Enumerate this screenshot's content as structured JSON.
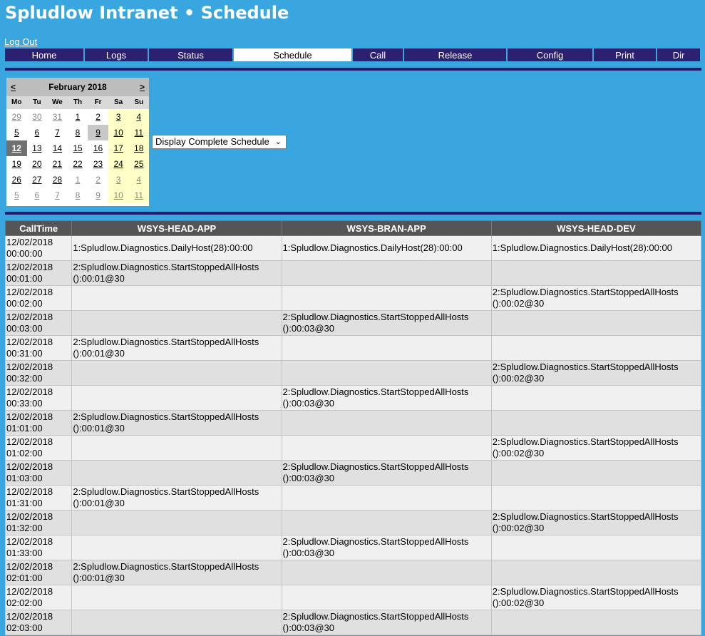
{
  "header": {
    "title": "Spludlow Intranet • Schedule",
    "logout": "Log Out"
  },
  "nav": [
    {
      "label": "Home",
      "active": false
    },
    {
      "label": "Logs",
      "active": false
    },
    {
      "label": "Status",
      "active": false
    },
    {
      "label": "Schedule",
      "active": true
    },
    {
      "label": "Call",
      "active": false
    },
    {
      "label": "Release",
      "active": false
    },
    {
      "label": "Config",
      "active": false
    },
    {
      "label": "Print",
      "active": false
    },
    {
      "label": "Dir",
      "active": false
    }
  ],
  "calendar": {
    "prev": "<",
    "next": ">",
    "month": "February 2018",
    "dows": [
      "Mo",
      "Tu",
      "We",
      "Th",
      "Fr",
      "Sa",
      "Su"
    ],
    "weeks": [
      [
        "29",
        "30",
        "31",
        "1",
        "2",
        "3",
        "4"
      ],
      [
        "5",
        "6",
        "7",
        "8",
        "9",
        "10",
        "11"
      ],
      [
        "12",
        "13",
        "14",
        "15",
        "16",
        "17",
        "18"
      ],
      [
        "19",
        "20",
        "21",
        "22",
        "23",
        "24",
        "25"
      ],
      [
        "26",
        "27",
        "28",
        "1",
        "2",
        "3",
        "4"
      ],
      [
        "5",
        "6",
        "7",
        "8",
        "9",
        "10",
        "11"
      ]
    ]
  },
  "filter": {
    "selected": "Display Complete Schedule"
  },
  "table": {
    "headers": [
      "CallTime",
      "WSYS-HEAD-APP",
      "WSYS-BRAN-APP",
      "WSYS-HEAD-DEV"
    ],
    "rows": [
      {
        "time": "12/02/2018 00:00:00",
        "c1": "1:Spludlow.Diagnostics.DailyHost(28):00:00",
        "c2": "1:Spludlow.Diagnostics.DailyHost(28):00:00",
        "c3": "1:Spludlow.Diagnostics.DailyHost(28):00:00"
      },
      {
        "time": "12/02/2018 00:01:00",
        "c1": "2:Spludlow.Diagnostics.StartStoppedAllHosts ():00:01@30",
        "c2": "",
        "c3": ""
      },
      {
        "time": "12/02/2018 00:02:00",
        "c1": "",
        "c2": "",
        "c3": "2:Spludlow.Diagnostics.StartStoppedAllHosts ():00:02@30"
      },
      {
        "time": "12/02/2018 00:03:00",
        "c1": "",
        "c2": "2:Spludlow.Diagnostics.StartStoppedAllHosts ():00:03@30",
        "c3": ""
      },
      {
        "time": "12/02/2018 00:31:00",
        "c1": "2:Spludlow.Diagnostics.StartStoppedAllHosts ():00:01@30",
        "c2": "",
        "c3": ""
      },
      {
        "time": "12/02/2018 00:32:00",
        "c1": "",
        "c2": "",
        "c3": "2:Spludlow.Diagnostics.StartStoppedAllHosts ():00:02@30"
      },
      {
        "time": "12/02/2018 00:33:00",
        "c1": "",
        "c2": "2:Spludlow.Diagnostics.StartStoppedAllHosts ():00:03@30",
        "c3": ""
      },
      {
        "time": "12/02/2018 01:01:00",
        "c1": "2:Spludlow.Diagnostics.StartStoppedAllHosts ():00:01@30",
        "c2": "",
        "c3": ""
      },
      {
        "time": "12/02/2018 01:02:00",
        "c1": "",
        "c2": "",
        "c3": "2:Spludlow.Diagnostics.StartStoppedAllHosts ():00:02@30"
      },
      {
        "time": "12/02/2018 01:03:00",
        "c1": "",
        "c2": "2:Spludlow.Diagnostics.StartStoppedAllHosts ():00:03@30",
        "c3": ""
      },
      {
        "time": "12/02/2018 01:31:00",
        "c1": "2:Spludlow.Diagnostics.StartStoppedAllHosts ():00:01@30",
        "c2": "",
        "c3": ""
      },
      {
        "time": "12/02/2018 01:32:00",
        "c1": "",
        "c2": "",
        "c3": "2:Spludlow.Diagnostics.StartStoppedAllHosts ():00:02@30"
      },
      {
        "time": "12/02/2018 01:33:00",
        "c1": "",
        "c2": "2:Spludlow.Diagnostics.StartStoppedAllHosts ():00:03@30",
        "c3": ""
      },
      {
        "time": "12/02/2018 02:01:00",
        "c1": "2:Spludlow.Diagnostics.StartStoppedAllHosts ():00:01@30",
        "c2": "",
        "c3": ""
      },
      {
        "time": "12/02/2018 02:02:00",
        "c1": "",
        "c2": "",
        "c3": "2:Spludlow.Diagnostics.StartStoppedAllHosts ():00:02@30"
      },
      {
        "time": "12/02/2018 02:03:00",
        "c1": "",
        "c2": "2:Spludlow.Diagnostics.StartStoppedAllHosts ():00:03@30",
        "c3": ""
      }
    ]
  }
}
